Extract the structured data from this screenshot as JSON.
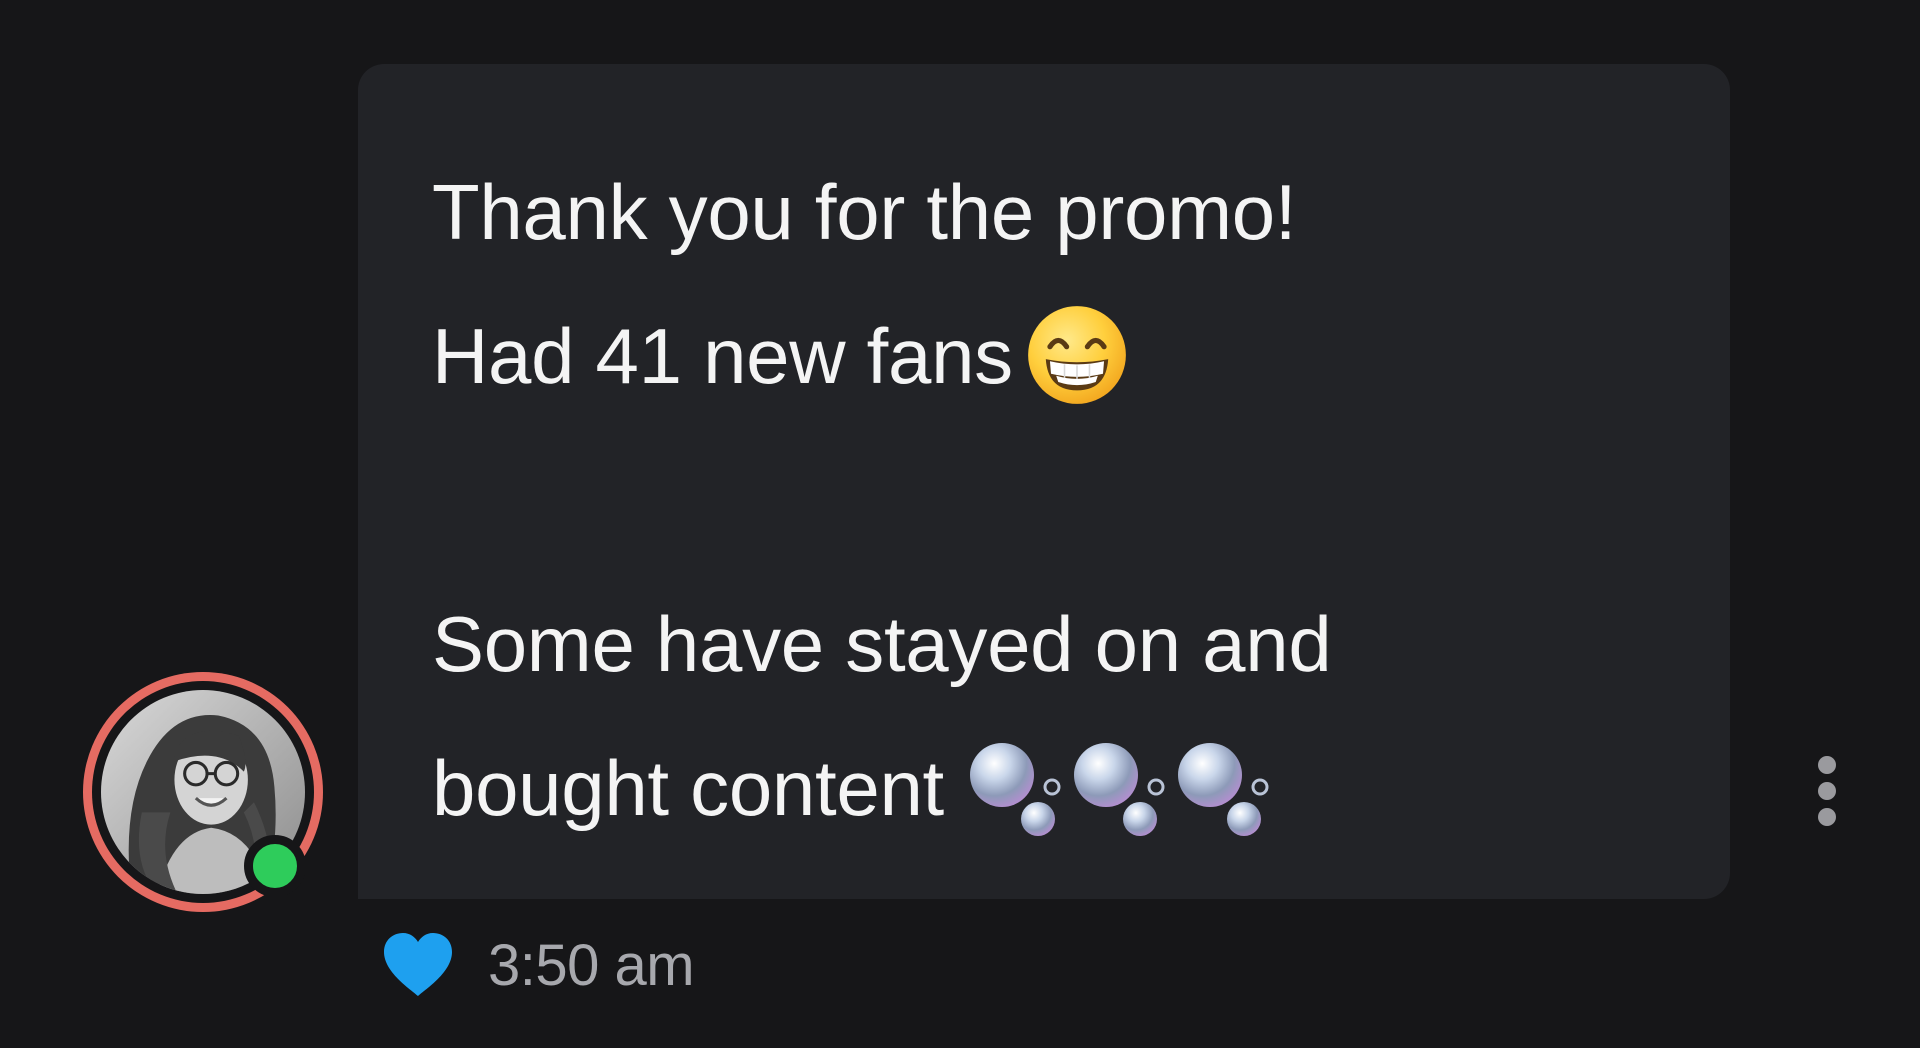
{
  "message": {
    "lines": [
      "Thank you for the promo!",
      "Had 41 new fans",
      "",
      "Some have stayed on and",
      "bought content"
    ],
    "emoji_after_line_2": "beaming-face-with-smiling-eyes",
    "emoji_after_line_5": "bubbles",
    "time": "3:50 am",
    "liked": true
  },
  "sender": {
    "online": true
  },
  "colors": {
    "background": "#161618",
    "bubble": "#222327",
    "text": "#f4f4f4",
    "timestamp": "#a7a8ad",
    "like": "#1ea0ef",
    "online": "#2ecc5b",
    "avatar_ring": "#e56b62"
  },
  "icons": {
    "like": "heart-icon",
    "more": "more-vertical-icon"
  }
}
